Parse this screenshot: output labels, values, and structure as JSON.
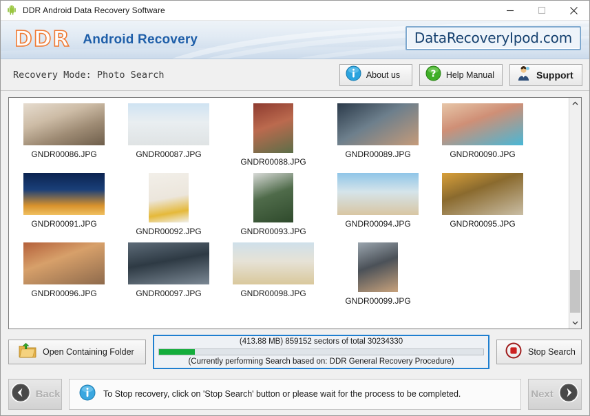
{
  "window": {
    "title": "DDR Android Data Recovery Software",
    "app_icon": "android-robot-icon",
    "controls": {
      "minimize": "minimize-icon",
      "maximize": "maximize-icon",
      "close": "close-icon"
    }
  },
  "header": {
    "logo": "DDR",
    "product": "Android Recovery",
    "website": "DataRecoveryIpod.com",
    "accent_orange": "#f07a33",
    "accent_blue": "#1f5fa9"
  },
  "mode_bar": {
    "mode_text": "Recovery Mode: Photo Search",
    "buttons": [
      {
        "label": "About us",
        "icon": "info-icon"
      },
      {
        "label": "Help Manual",
        "icon": "question-icon"
      },
      {
        "label": "Support",
        "icon": "support-person-icon"
      }
    ]
  },
  "files": [
    {
      "name": "GNDR00086.JPG",
      "shape": "wide"
    },
    {
      "name": "GNDR00087.JPG",
      "shape": "wide"
    },
    {
      "name": "GNDR00088.JPG",
      "shape": "tall"
    },
    {
      "name": "GNDR00089.JPG",
      "shape": "wide"
    },
    {
      "name": "GNDR00090.JPG",
      "shape": "wide"
    },
    {
      "name": "GNDR00091.JPG",
      "shape": "wide"
    },
    {
      "name": "GNDR00092.JPG",
      "shape": "tall"
    },
    {
      "name": "GNDR00093.JPG",
      "shape": "tall"
    },
    {
      "name": "GNDR00094.JPG",
      "shape": "wide"
    },
    {
      "name": "GNDR00095.JPG",
      "shape": "wide"
    },
    {
      "name": "GNDR00096.JPG",
      "shape": "wide"
    },
    {
      "name": "GNDR00097.JPG",
      "shape": "wide"
    },
    {
      "name": "GNDR00098.JPG",
      "shape": "wide"
    },
    {
      "name": "GNDR00099.JPG",
      "shape": "tall"
    }
  ],
  "actions": {
    "open_folder_label": "Open Containing Folder",
    "open_folder_icon": "folder-upload-icon",
    "stop_label": "Stop Search",
    "stop_icon": "stop-record-icon"
  },
  "progress": {
    "status_top": "(413.88 MB) 859152  sectors  of  total 30234330",
    "status_bottom": "(Currently performing Search based on:  DDR General Recovery Procedure)",
    "size_mb": "413.88 MB",
    "sectors_done": "859152",
    "sectors_total": "30234330",
    "percent": 11,
    "fill_color": "#14ad3c",
    "border_color": "#1f7fd0"
  },
  "footer": {
    "back_label": "Back",
    "back_icon": "chevron-left-circle-icon",
    "next_label": "Next",
    "next_icon": "chevron-right-circle-icon",
    "message": "To Stop recovery, click on 'Stop Search' button or please wait for the process to be completed.",
    "message_icon": "info-icon"
  }
}
